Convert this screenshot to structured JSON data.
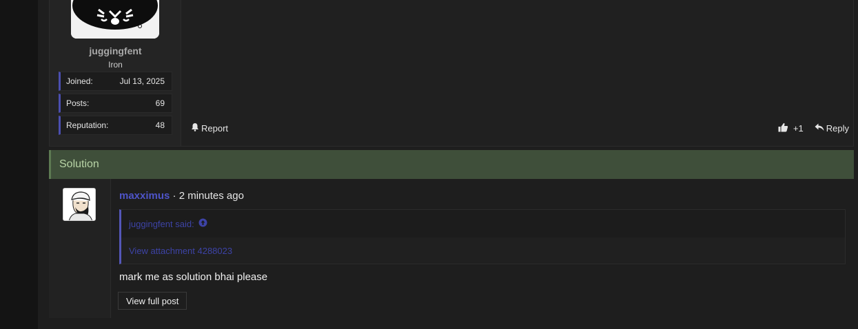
{
  "upper_post": {
    "username": "juggingfent",
    "rank": "Iron",
    "stats": [
      {
        "label": "Joined:",
        "value": "Jul 13, 2025"
      },
      {
        "label": "Posts:",
        "value": "69"
      },
      {
        "label": "Reputation:",
        "value": "48"
      }
    ],
    "actions": {
      "report_label": "Report",
      "like_count": "+1",
      "reply_label": "Reply"
    }
  },
  "solution_banner": {
    "label": "Solution",
    "color": "#3f4f3a"
  },
  "solution_post": {
    "author": "maxximus",
    "separator": "·",
    "time": "2 minutes ago",
    "quote": {
      "attribution": "juggingfent said:",
      "body": "View attachment 4288023"
    },
    "message": "mark me as solution bhai please",
    "view_full_label": "View full post"
  },
  "icons": [
    "bell-icon",
    "thumbs-up-icon",
    "reply-arrow-icon",
    "arrow-up-circle-icon"
  ],
  "colors": {
    "accent": "#4e54c8",
    "background": "#1e1e1e"
  }
}
